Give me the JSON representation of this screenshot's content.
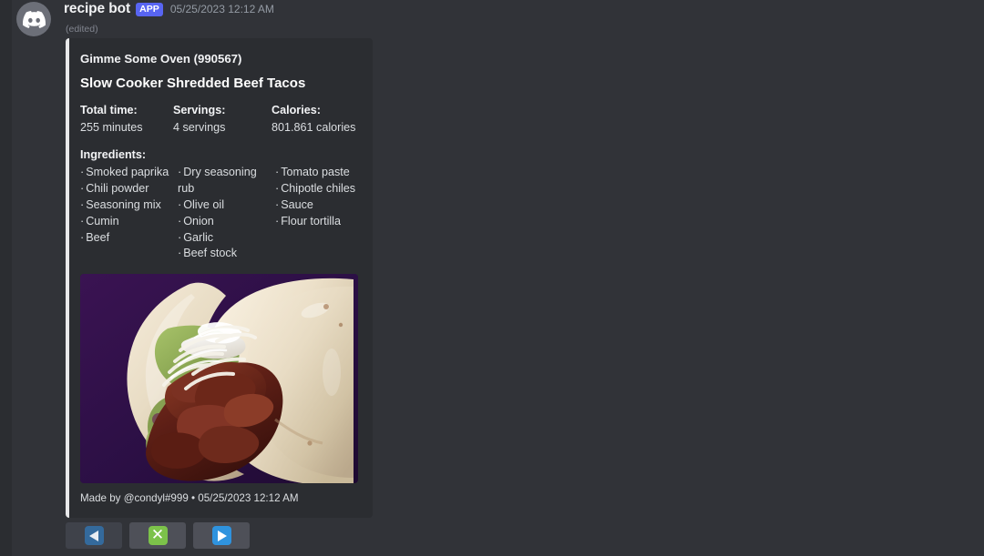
{
  "colors": {
    "page_background": "#313338",
    "embed_background": "#2b2d31",
    "embed_accent_bar": "#e8e9ea",
    "app_badge": "#5865f2",
    "button_background": "#4e5058",
    "emoji_blue_dim": "#346a9c",
    "emoji_blue": "#2f93de",
    "emoji_green": "#7cc24a",
    "image_backdrop": "#2d1040"
  },
  "message": {
    "avatar_icon": "discord-logo-icon",
    "author": "recipe bot",
    "app_badge": "APP",
    "timestamp": "05/25/2023 12:12 AM",
    "edited_marker": "(edited)"
  },
  "embed": {
    "author": "Gimme Some Oven (990567)",
    "title": "Slow Cooker Shredded Beef Tacos",
    "fields": [
      {
        "name": "Total time:",
        "value": "255 minutes"
      },
      {
        "name": "Servings:",
        "value": "4 servings"
      },
      {
        "name": "Calories:",
        "value": "801.861 calories"
      }
    ],
    "ingredients_heading": "Ingredients:",
    "ingredients_columns": [
      [
        "Smoked paprika",
        "Chili powder",
        "Seasoning mix",
        "Cumin",
        "Beef"
      ],
      [
        "Dry seasoning rub",
        "Olive oil",
        "Onion",
        "Garlic",
        "Beef stock"
      ],
      [
        "Tomato paste",
        "Chipotle chiles",
        "Sauce",
        "Flour tortilla"
      ]
    ],
    "bullet": "·",
    "image_alt": "shredded beef taco in flour tortilla on purple background",
    "footer": "Made by @condyl#999 • 05/25/2023 12:12 AM"
  },
  "components": [
    {
      "name": "previous-page-button",
      "emoji": "left-triangle-icon",
      "style": "dim"
    },
    {
      "name": "delete-button",
      "emoji": "cross-mark-icon",
      "style": "normal"
    },
    {
      "name": "next-page-button",
      "emoji": "right-triangle-icon",
      "style": "normal"
    }
  ]
}
